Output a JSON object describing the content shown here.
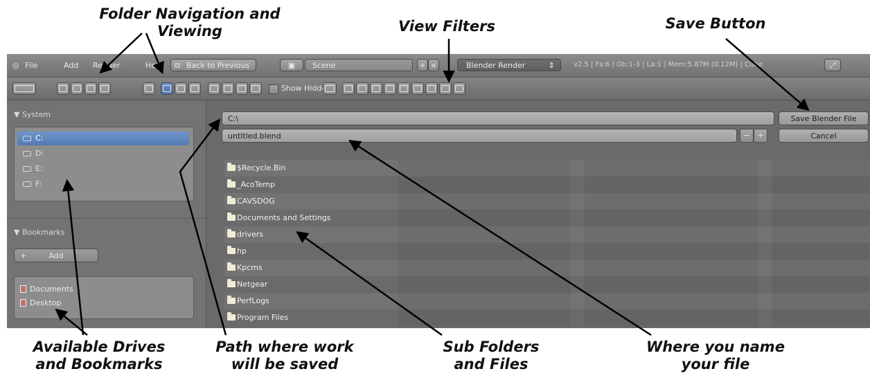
{
  "annotations": {
    "folder_nav": [
      "Folder Navigation and",
      "Viewing"
    ],
    "view_filters": "View Filters",
    "save_button": "Save Button",
    "drives": [
      "Available Drives",
      "and Bookmarks"
    ],
    "path": [
      "Path where work",
      "will be saved"
    ],
    "subfolders": [
      "Sub Folders",
      "and Files"
    ],
    "name_file": [
      "Where you name",
      "your file"
    ]
  },
  "header": {
    "menu": [
      "File",
      "Add",
      "Render",
      "Help"
    ],
    "back_label": "Back to Previous",
    "scene": "Scene",
    "engine": "Blender Render",
    "info": "v2.5 | Fs:6 | Ob:1-3 | La:1 | Mem:5.87M (0.12M) | Cube"
  },
  "toolbar": {
    "show_hidden": "Show Hidden"
  },
  "left": {
    "system_title": "System",
    "drives": [
      "C:",
      "D:",
      "E:",
      "F:"
    ],
    "bookmarks_title": "Bookmarks",
    "add_label": "Add",
    "bookmarks": [
      "Documents",
      "Desktop"
    ]
  },
  "main": {
    "path": "C:\\",
    "filename": "untitled.blend",
    "save_label": "Save Blender File",
    "cancel_label": "Cancel",
    "files": [
      "$Recycle.Bin",
      "_AcoTemp",
      "CAVSDOG",
      "Documents and Settings",
      "drivers",
      "hp",
      "Kpcms",
      "Netgear",
      "PerfLogs",
      "Program Files"
    ]
  },
  "colors": {
    "accent": "#5a80ba",
    "panel": "#737373"
  }
}
